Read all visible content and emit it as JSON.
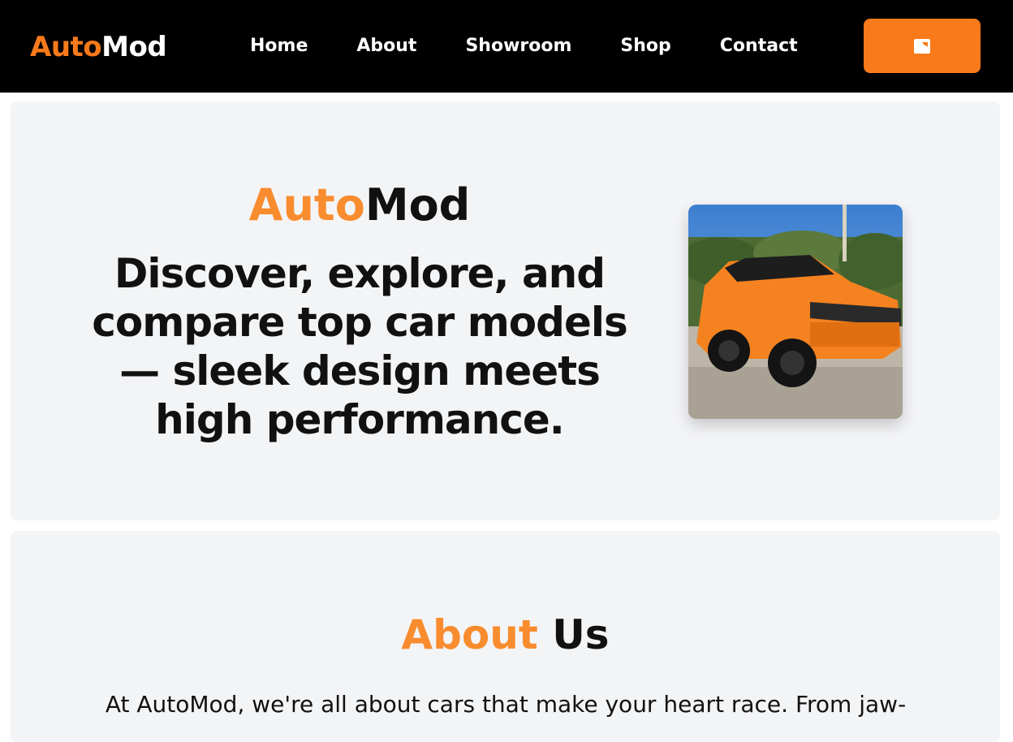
{
  "nav": {
    "logo_part1": "Auto",
    "logo_part2": "Mod",
    "links": [
      "Home",
      "About",
      "Showroom",
      "Shop",
      "Contact"
    ],
    "cta_icon": "image-icon",
    "accent_color": "#f97a1a"
  },
  "hero": {
    "brand_part1": "Auto",
    "brand_part2": "Mod",
    "tagline": "Discover, explore, and compare top car models — sleek design meets high performance.",
    "image_subject": "orange SUV"
  },
  "about": {
    "title_part1": "About",
    "title_part2": "Us",
    "text": "At AutoMod, we're all about cars that make your heart race. From jaw-"
  }
}
